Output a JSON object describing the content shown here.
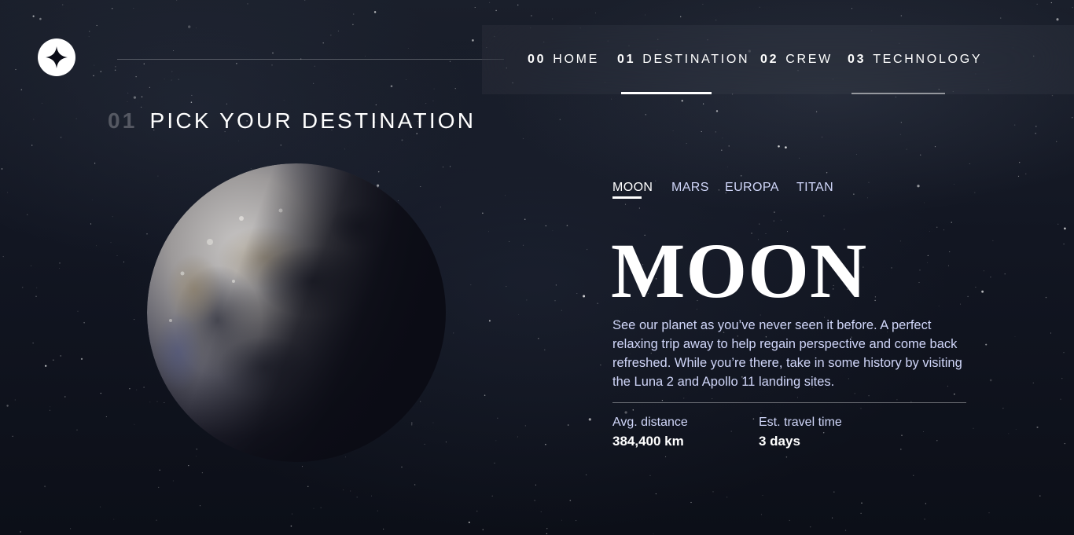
{
  "colors": {
    "background": "#0b0d17",
    "accent": "#ffffff",
    "muted_text": "#d0d6f9",
    "nav_hover_underline": "#979797"
  },
  "header": {
    "logo_icon": "star-icon",
    "nav": [
      {
        "number": "00",
        "label": "HOME",
        "active": false
      },
      {
        "number": "01",
        "label": "DESTINATION",
        "active": true
      },
      {
        "number": "02",
        "label": "CREW",
        "active": false
      },
      {
        "number": "03",
        "label": "TECHNOLOGY",
        "active": false
      }
    ]
  },
  "page": {
    "heading_number": "01",
    "heading_text": "PICK YOUR DESTINATION"
  },
  "destination": {
    "image_icon": "moon-image",
    "tabs": [
      {
        "label": "MOON",
        "active": true
      },
      {
        "label": "MARS",
        "active": false
      },
      {
        "label": "EUROPA",
        "active": false
      },
      {
        "label": "TITAN",
        "active": false
      }
    ],
    "name": "MOON",
    "description": "See our planet as you’ve never seen it before. A perfect relaxing trip away to help regain perspective and come back refreshed. While you’re there, take in some history by visiting the Luna 2 and Apollo 11 landing sites.",
    "stats": {
      "distance_label": "Avg. distance",
      "distance_value": "384,400 km",
      "travel_label": "Est. travel time",
      "travel_value": "3 days"
    }
  }
}
